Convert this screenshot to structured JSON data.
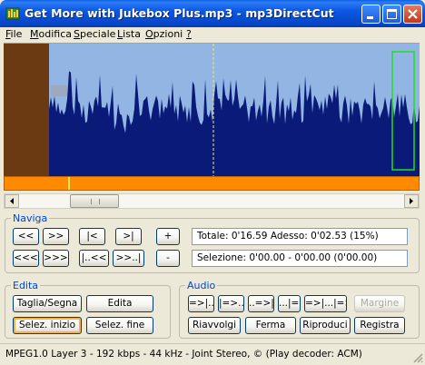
{
  "window": {
    "title": "Get More with Jukebox Plus.mp3 - mp3DirectCut"
  },
  "menu": [
    {
      "label_u": "F",
      "label_rest": "ile"
    },
    {
      "label_u": "M",
      "label_rest": "odifica"
    },
    {
      "label_u": "S",
      "label_rest": "peciale"
    },
    {
      "label_u": "L",
      "label_rest": "ista"
    },
    {
      "label_u": "O",
      "label_rest": "pzioni"
    },
    {
      "label_u": "?",
      "label_rest": ""
    }
  ],
  "colors": {
    "wave_bg": "#92B5E3",
    "wave_fill": "#0A1A78",
    "selection_bg": "#6B3A12",
    "position_strip": "#FF8A00",
    "group_title": "#0046D5"
  },
  "naviga": {
    "title": "Naviga",
    "buttons_row1": [
      "<<",
      ">>",
      "|<",
      ">|",
      "+"
    ],
    "buttons_row2": [
      "<<<",
      ">>>",
      "|..<<",
      ">>..|",
      "-"
    ],
    "total": "Totale: 0'16.59   Adesso: 0'02.53  (15%)",
    "selection": "Selezione: 0'00.00 - 0'00.00 (0'00.00)"
  },
  "edita": {
    "title": "Edita",
    "cut": "Taglia/Segna",
    "edit": "Edita",
    "sel_start": "Selez. inizio",
    "sel_end": "Selez. fine"
  },
  "audio": {
    "title": "Audio",
    "row1": [
      "=>|...",
      "|=>...",
      "..=>|",
      "...|=>",
      "=>|...|=>"
    ],
    "margins": "Margine",
    "rewind": "Riavvolgi",
    "stop": "Ferma",
    "play": "Riproduci",
    "record": "Registra"
  },
  "status": "MPEG1.0 Layer 3 - 192 kbps - 44 kHz - Joint Stereo, ©   (Play decoder: ACM)"
}
